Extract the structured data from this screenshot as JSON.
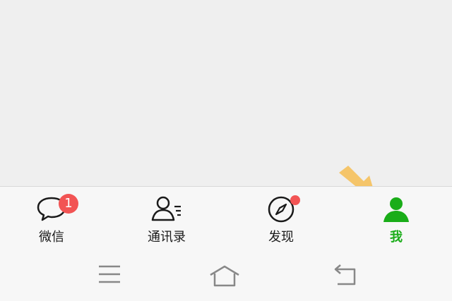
{
  "tabbar": {
    "items": [
      {
        "label": "微信",
        "icon": "chat-bubble-icon",
        "badge": "1"
      },
      {
        "label": "通讯录",
        "icon": "contacts-icon"
      },
      {
        "label": "发现",
        "icon": "compass-icon",
        "dot": true
      },
      {
        "label": "我",
        "icon": "person-icon",
        "active": true
      }
    ]
  },
  "colors": {
    "accent": "#1aad19",
    "badge": "#f25454",
    "arrow": "#f5c56a"
  },
  "navbar": {
    "buttons": [
      "menu-icon",
      "home-icon",
      "back-icon"
    ]
  }
}
